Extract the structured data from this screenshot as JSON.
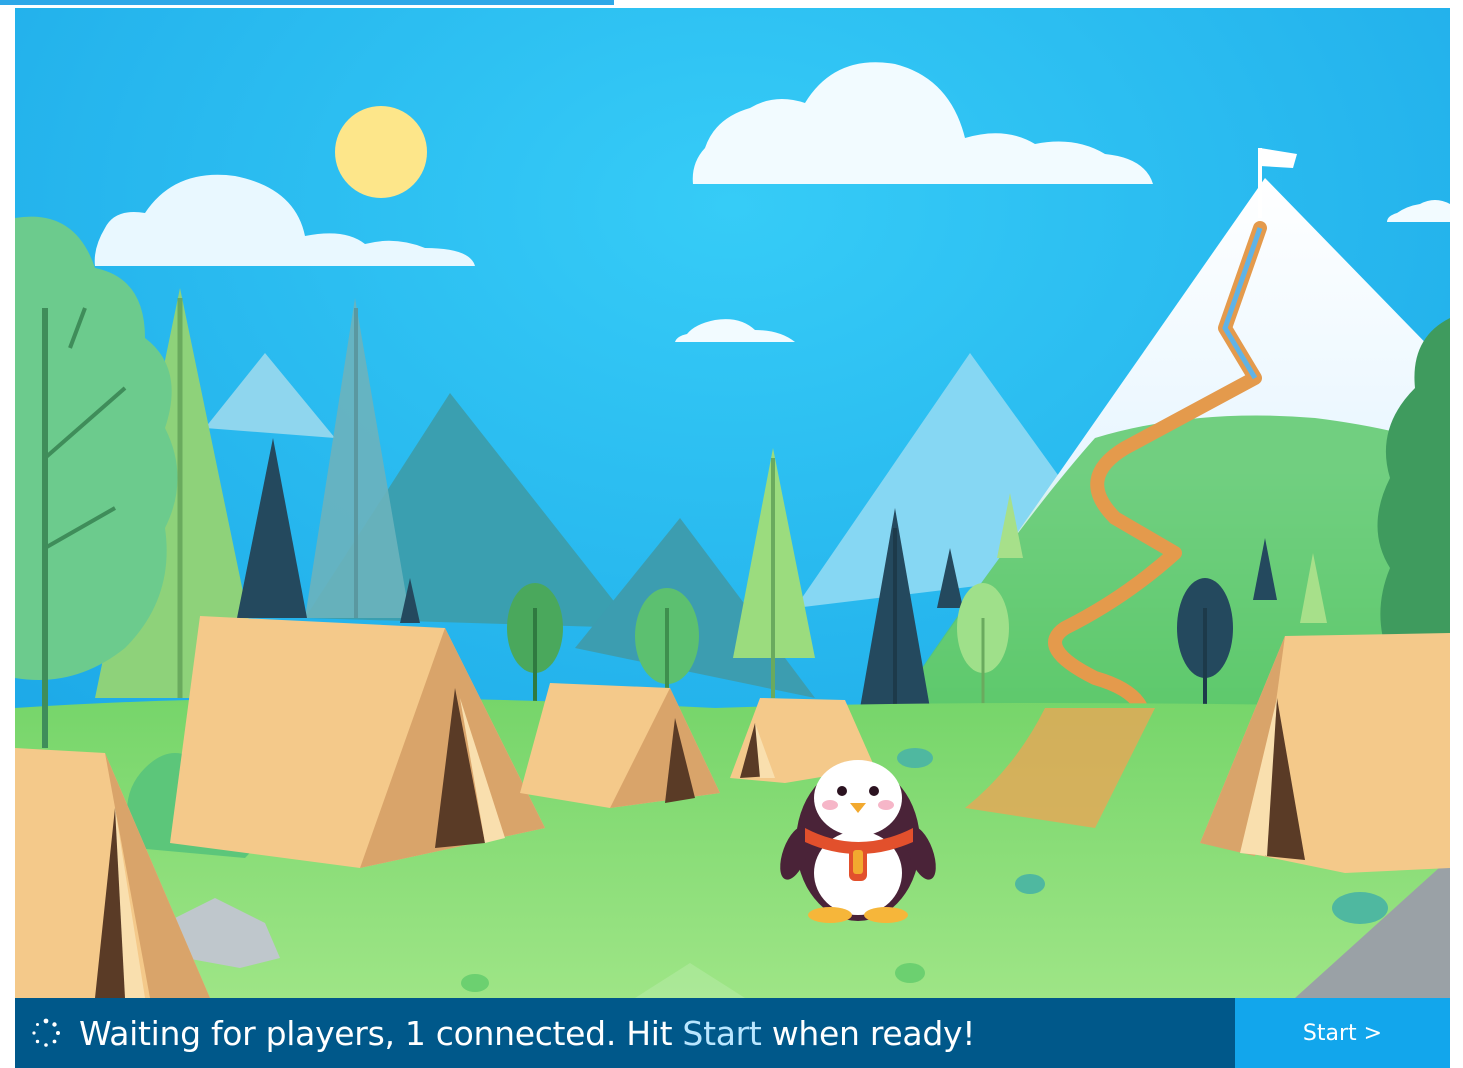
{
  "progress": {
    "fraction": 0.42,
    "color": "#2ea8e8"
  },
  "status": {
    "prefix": "Waiting for players, 1 connected. Hit ",
    "highlight": "Start",
    "suffix": " when ready!",
    "icon": "spinner-icon"
  },
  "start_button": {
    "label": "Start >"
  },
  "colors": {
    "sky": "#29bdf0",
    "status_bar": "#00588a",
    "start_button": "#12a6ec",
    "grass": "#8ee07a",
    "tent": "#f4c98a"
  }
}
